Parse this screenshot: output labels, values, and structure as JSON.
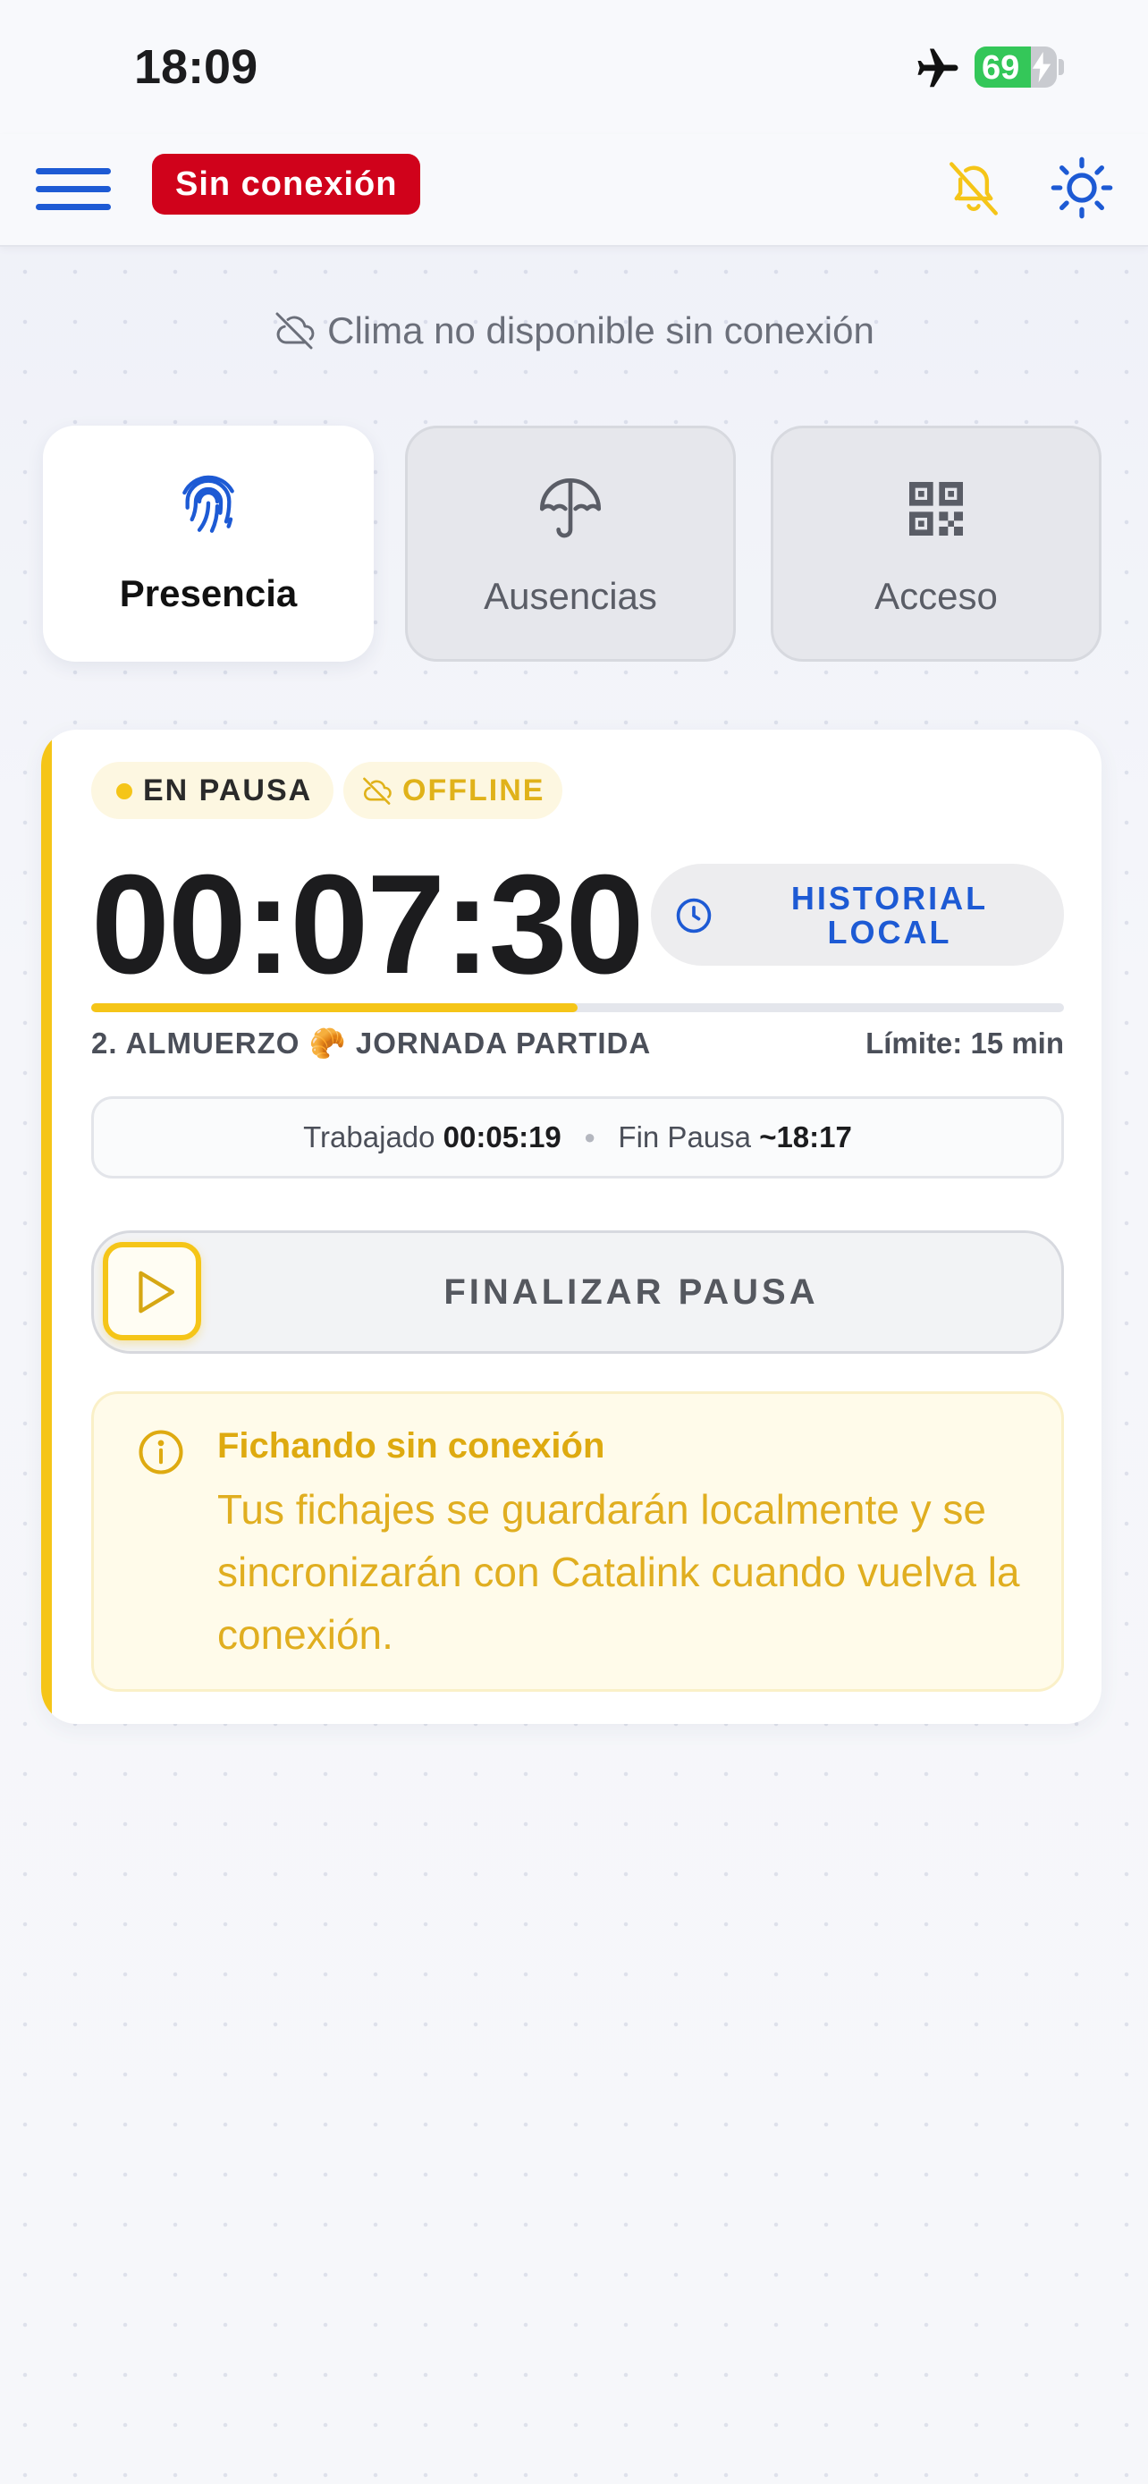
{
  "status_bar": {
    "time": "18:09",
    "battery_level": "69",
    "battery_fraction": 0.69,
    "icons": [
      "airplane-mode-icon",
      "battery-charging-icon"
    ]
  },
  "header": {
    "offline_badge": "Sin conexión",
    "icons": [
      "menu-icon",
      "bell-off-icon",
      "sun-icon"
    ]
  },
  "weather": {
    "text": "Clima no disponible sin conexión",
    "icon": "cloud-off-icon"
  },
  "tabs": [
    {
      "label": "Presencia",
      "icon": "fingerprint-icon",
      "active": true
    },
    {
      "label": "Ausencias",
      "icon": "umbrella-icon",
      "active": false
    },
    {
      "label": "Acceso",
      "icon": "qr-code-icon",
      "active": false
    }
  ],
  "session": {
    "status_pill": "EN PAUSA",
    "offline_pill": "OFFLINE",
    "timer": "00:07:30",
    "history_button": {
      "line1": "HISTORIAL",
      "line2": "LOCAL"
    },
    "progress_fraction": 0.5,
    "break_name": "2. ALMUERZO 🥐 JORNADA PARTIDA",
    "limit": "Límite: 15 min",
    "worked_label": "Trabajado",
    "worked_value": "00:05:19",
    "end_label": "Fin Pausa",
    "end_value": "~18:17",
    "end_button": "FINALIZAR PAUSA"
  },
  "notice": {
    "title": "Fichando sin conexión",
    "body": "Tus fichajes se guardarán localmente y se sincronizarán con Catalink cuando vuelva la conexión."
  },
  "colors": {
    "accent_blue": "#1d5ad4",
    "offline_red": "#d0021b",
    "pause_yellow": "#f5c518",
    "notice_text": "#e0ae20"
  }
}
